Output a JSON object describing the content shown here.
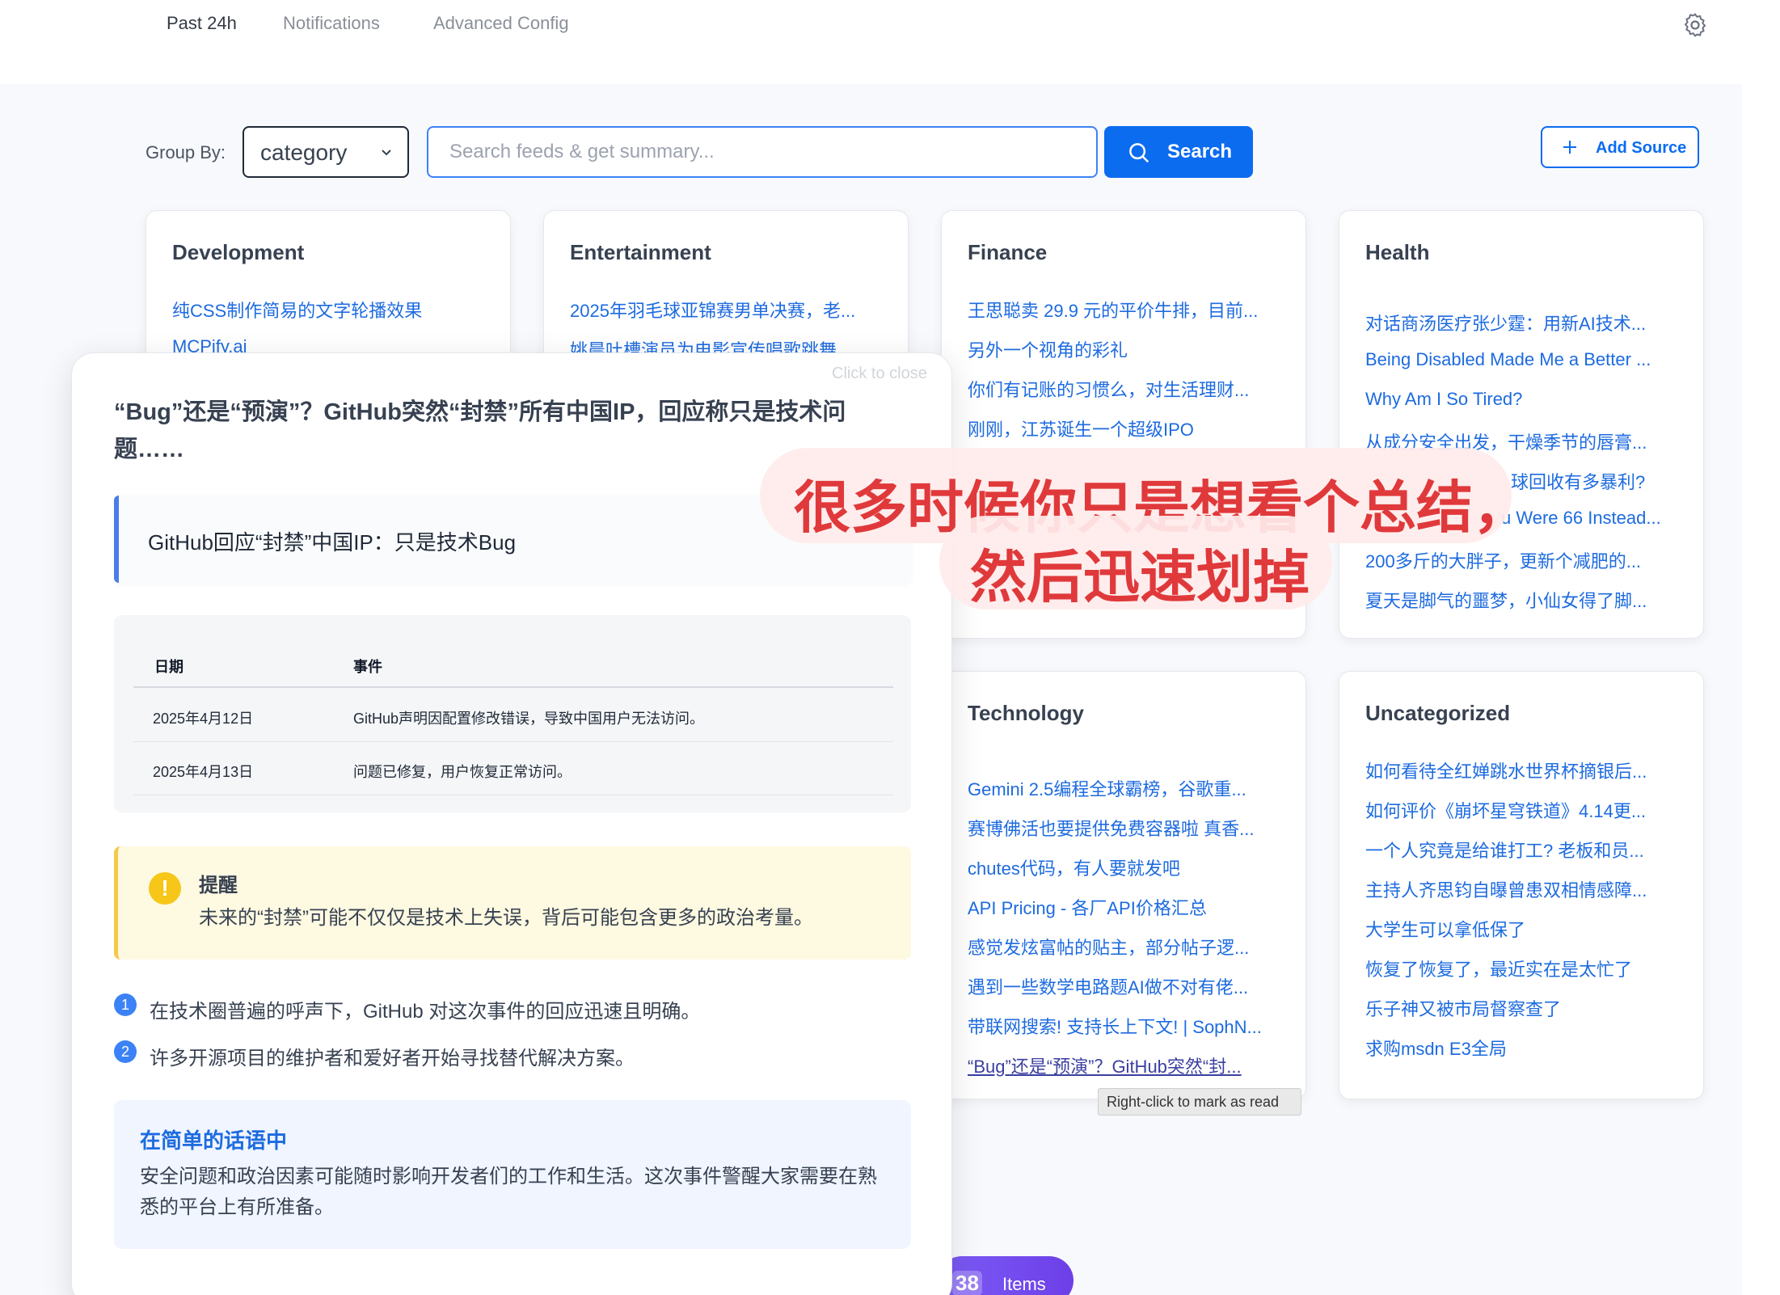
{
  "nav": {
    "tabs": [
      {
        "label": "Past 24h"
      },
      {
        "label": "Notifications"
      },
      {
        "label": "Advanced Config"
      }
    ],
    "settings_icon": "gear-icon"
  },
  "toolbar": {
    "group_by_label": "Group By:",
    "group_by_value": "category",
    "search_placeholder": "Search feeds & get summary...",
    "search_label": "Search",
    "add_source_label": "Add Source"
  },
  "cards": [
    {
      "title": "Development",
      "items": [
        "纯CSS制作简易的文字轮播效果",
        "MCPify.ai"
      ]
    },
    {
      "title": "Entertainment",
      "items": [
        "2025年羽毛球亚锦赛男单决赛，老...",
        "姚晨吐槽演员为电影宣传唱歌跳舞"
      ]
    },
    {
      "title": "Finance",
      "items": [
        "王思聪卖 29.9 元的平价牛排，目前...",
        "另外一个视角的彩礼",
        "你们有记账的习惯么，对生活理财...",
        "刚刚，江苏诞生一个超级IPO"
      ]
    },
    {
      "title": "Health",
      "items": [
        "对话商汤医疗张少霆：用新AI技术...",
        "Being Disabled Made Me a Better ...",
        "Why Am I So Tired?",
        "从成分安全出发，干燥季节的唇膏...",
        "球回收有多暴利?",
        "u Were 66 Instead...",
        "200多斤的大胖子，更新个减肥的...",
        "夏天是脚气的噩梦，小仙女得了脚..."
      ]
    },
    {
      "title": "Technology",
      "items": [
        "Gemini 2.5编程全球霸榜，谷歌重...",
        "赛博佛活也要提供免费容器啦 真香...",
        "chutes代码，有人要就发吧",
        "API Pricing - 各厂API价格汇总",
        "感觉发炫富帖的贴主，部分帖子逻...",
        "遇到一些数学电路题AI做不对有佬...",
        "带联网搜索! 支持长上下文! | SophN...",
        "“Bug”还是“预演”？GitHub突然“封..."
      ]
    },
    {
      "title": "Uncategorized",
      "items": [
        "如何看待全红婵跳水世界杯摘银后...",
        "如何评价《崩坏星穹铁道》4.14更...",
        "一个人究竟是给谁打工? 老板和员...",
        "主持人齐思钧自曝曾患双相情感障...",
        "大学生可以拿低保了",
        "恢复了恢复了，最近实在是太忙了",
        "乐子神又被市局督察查了",
        "求购msdn E3全局"
      ]
    }
  ],
  "tooltip": "Right-click to mark as read",
  "items_count": {
    "num": "38",
    "label": "Items"
  },
  "summary": {
    "close_hint": "Click to close",
    "title": "“Bug”还是“预演”？GitHub突然“封禁”所有中国IP，回应称只是技术问题……",
    "quote": "GitHub回应“封禁”中国IP：只是技术Bug",
    "table": {
      "headers": [
        "日期",
        "事件"
      ],
      "rows": [
        [
          "2025年4月12日",
          "GitHub声明因配置修改错误，导致中国用户无法访问。"
        ],
        [
          "2025年4月13日",
          "问题已修复，用户恢复正常访问。"
        ]
      ]
    },
    "reminder": {
      "title": "提醒",
      "body": "未来的“封禁”可能不仅仅是技术上失误，背后可能包含更多的政治考量。",
      "icon": "!"
    },
    "points": [
      {
        "n": "1",
        "text": "在技术圈普遍的呼声下，GitHub 对这次事件的回应迅速且明确。"
      },
      {
        "n": "2",
        "text": "许多开源项目的维护者和爱好者开始寻找替代解决方案。"
      }
    ],
    "simple": {
      "title": "在简单的话语中",
      "body": "安全问题和政治因素可能随时影响开发者们的工作和生活。这次事件警醒大家需要在熟悉的平台上有所准备。"
    }
  },
  "caption": {
    "line1": "很多时候你只是想看个总结，",
    "line2": "然后迅速划掉"
  },
  "colors": {
    "accent": "#0b6cf0",
    "link": "#1d6be0",
    "caption": "#e0393b",
    "warn_bg": "#fef9e1"
  }
}
